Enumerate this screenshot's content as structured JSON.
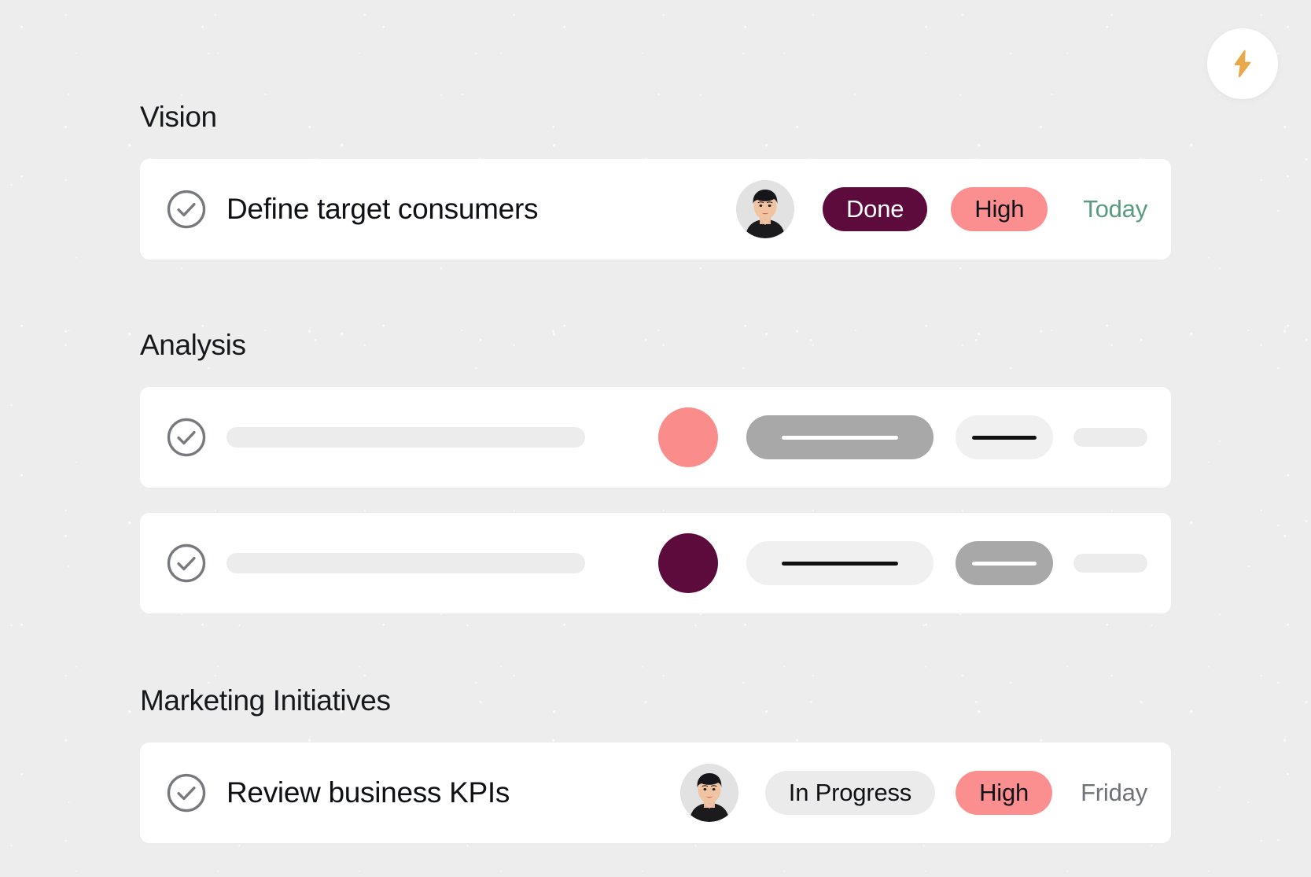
{
  "header": {
    "bolt_button": {
      "icon": "lightning-bolt-icon",
      "icon_color": "#e9a94a",
      "background": "#ffffff"
    }
  },
  "colors": {
    "page_background": "#ededed",
    "card_background": "#ffffff",
    "done_pill": "#5d0b3c",
    "high_pill": "#fb8f8f",
    "progress_pill": "#ebebeb",
    "today_text": "#5a9b80",
    "friday_text": "#6f7377",
    "skeleton_gray": "#a8a8a8",
    "skeleton_light": "#f0f0f0",
    "skeleton_bar": "#ececec"
  },
  "sections": [
    {
      "title": "Vision",
      "rows": [
        {
          "type": "task",
          "checkbox_icon": "check-circle-icon",
          "title": "Define target consumers",
          "avatar": "user-avatar",
          "status": "Done",
          "status_style": "done",
          "priority": "High",
          "priority_style": "high",
          "due": "Today",
          "due_style": "today"
        }
      ]
    },
    {
      "title": "Analysis",
      "rows": [
        {
          "type": "skeleton",
          "checkbox_icon": "check-circle-icon",
          "avatar_color": "salmon",
          "status_pill": "gray",
          "priority_pill": "light",
          "tail": true
        },
        {
          "type": "skeleton",
          "checkbox_icon": "check-circle-icon",
          "avatar_color": "plum",
          "status_pill": "light",
          "priority_pill": "gray",
          "tail": true
        }
      ]
    },
    {
      "title": "Marketing Initiatives",
      "rows": [
        {
          "type": "task",
          "checkbox_icon": "check-circle-icon",
          "title": "Review business KPIs",
          "avatar": "user-avatar",
          "status": "In Progress",
          "status_style": "progress",
          "priority": "High",
          "priority_style": "high",
          "due": "Friday",
          "due_style": "friday"
        }
      ]
    }
  ]
}
